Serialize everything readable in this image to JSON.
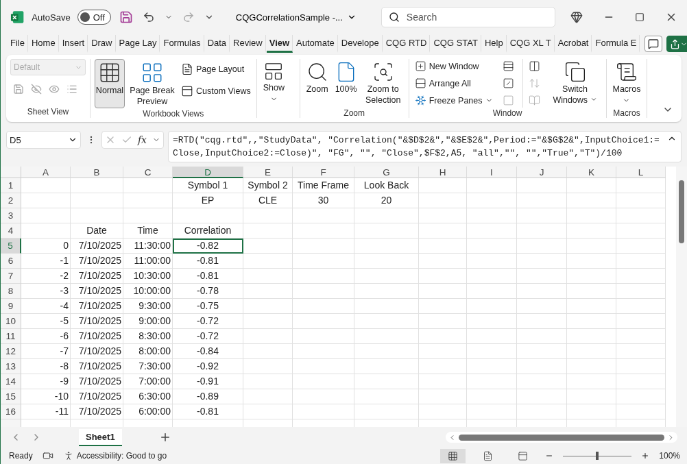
{
  "title_bar": {
    "autosave_label": "AutoSave",
    "autosave": {
      "on": false,
      "label": "Off"
    },
    "title": "CQGCorrelationSample  -...",
    "search": {
      "placeholder": "Search"
    }
  },
  "ribbon_tabs": [
    {
      "label": "File",
      "selected": false
    },
    {
      "label": "Home",
      "selected": false
    },
    {
      "label": "Insert",
      "selected": false
    },
    {
      "label": "Draw",
      "selected": false
    },
    {
      "label": "Page Lay",
      "selected": false
    },
    {
      "label": "Formulas",
      "selected": false
    },
    {
      "label": "Data",
      "selected": false
    },
    {
      "label": "Review",
      "selected": false
    },
    {
      "label": "View",
      "selected": true
    },
    {
      "label": "Automate",
      "selected": false
    },
    {
      "label": "Develope",
      "selected": false
    },
    {
      "label": "CQG RTD",
      "selected": false
    },
    {
      "label": "CQG STAT",
      "selected": false
    },
    {
      "label": "Help",
      "selected": false
    },
    {
      "label": "CQG XL T",
      "selected": false
    },
    {
      "label": "Acrobat",
      "selected": false
    },
    {
      "label": "Formula E",
      "selected": false
    }
  ],
  "ribbon": {
    "sheet_view": {
      "label": "Sheet View",
      "dropdown": {
        "value": "Default",
        "disabled": true
      }
    },
    "workbook_views": {
      "label": "Workbook Views",
      "items": [
        {
          "label": "Normal",
          "selected": true
        },
        {
          "label": "Page Break Preview",
          "selected": false
        },
        {
          "label": "Page Layout",
          "selected": false
        },
        {
          "label": "Custom Views",
          "selected": false
        }
      ]
    },
    "show": {
      "label": "Show"
    },
    "zoom": {
      "label": "Zoom",
      "items": [
        "Zoom",
        "100%",
        "Zoom to Selection"
      ]
    },
    "window": {
      "label": "Window",
      "items": [
        "New Window",
        "Arrange All",
        "Freeze Panes",
        "Switch Windows"
      ]
    },
    "macros": {
      "label": "Macros",
      "button": "Macros"
    }
  },
  "formula_bar": {
    "name_box": "D5",
    "fx": "fx",
    "formula": "=RTD(\"cqg.rtd\",,\"StudyData\", \"Correlation(\"&$D$2&\",\"&$E$2&\",Period:=\"&$G$2&\",InputChoice1:=Close,InputChoice2:=Close)\", \"FG\", \"\", \"Close\",$F$2,A5, \"all\",\"\", \"\",\"True\",\"T\")/100"
  },
  "grid": {
    "columns": [
      {
        "label": "A",
        "selected": false
      },
      {
        "label": "B",
        "selected": false
      },
      {
        "label": "C",
        "selected": false
      },
      {
        "label": "D",
        "selected": true
      },
      {
        "label": "E",
        "selected": false
      },
      {
        "label": "F",
        "selected": false
      },
      {
        "label": "G",
        "selected": false
      },
      {
        "label": "H",
        "selected": false
      },
      {
        "label": "I",
        "selected": false
      },
      {
        "label": "J",
        "selected": false
      },
      {
        "label": "K",
        "selected": false
      },
      {
        "label": "L",
        "selected": false
      }
    ],
    "rows": [
      {
        "label": "1",
        "selected": false,
        "kind": "label",
        "cells": [
          null,
          null,
          null,
          "Symbol 1",
          "Symbol 2",
          "Time Frame",
          "Look Back"
        ]
      },
      {
        "label": "2",
        "selected": false,
        "kind": "label",
        "cells": [
          null,
          null,
          null,
          "EP",
          "CLE",
          "30",
          "20"
        ]
      },
      {
        "label": "3",
        "selected": false,
        "kind": "label"
      },
      {
        "label": "4",
        "selected": false,
        "kind": "label",
        "cells": [
          null,
          "Date",
          "Time",
          "Correlation"
        ]
      },
      {
        "label": "5",
        "selected": true,
        "kind": "data",
        "cells": [
          "0",
          "7/10/2025",
          "11:30:00",
          "-0.82"
        ]
      },
      {
        "label": "6",
        "selected": false,
        "kind": "data",
        "cells": [
          "-1",
          "7/10/2025",
          "11:00:00",
          "-0.81"
        ]
      },
      {
        "label": "7",
        "selected": false,
        "kind": "data",
        "cells": [
          "-2",
          "7/10/2025",
          "10:30:00",
          "-0.81"
        ]
      },
      {
        "label": "8",
        "selected": false,
        "kind": "data",
        "cells": [
          "-3",
          "7/10/2025",
          "10:00:00",
          "-0.78"
        ]
      },
      {
        "label": "9",
        "selected": false,
        "kind": "data",
        "cells": [
          "-4",
          "7/10/2025",
          "9:30:00",
          "-0.75"
        ]
      },
      {
        "label": "10",
        "selected": false,
        "kind": "data",
        "cells": [
          "-5",
          "7/10/2025",
          "9:00:00",
          "-0.72"
        ]
      },
      {
        "label": "11",
        "selected": false,
        "kind": "data",
        "cells": [
          "-6",
          "7/10/2025",
          "8:30:00",
          "-0.72"
        ]
      },
      {
        "label": "12",
        "selected": false,
        "kind": "data",
        "cells": [
          "-7",
          "7/10/2025",
          "8:00:00",
          "-0.84"
        ]
      },
      {
        "label": "13",
        "selected": false,
        "kind": "data",
        "cells": [
          "-8",
          "7/10/2025",
          "7:30:00",
          "-0.92"
        ]
      },
      {
        "label": "14",
        "selected": false,
        "kind": "data",
        "cells": [
          "-9",
          "7/10/2025",
          "7:00:00",
          "-0.91"
        ]
      },
      {
        "label": "15",
        "selected": false,
        "kind": "data",
        "cells": [
          "-10",
          "7/10/2025",
          "6:30:00",
          "-0.89"
        ]
      },
      {
        "label": "16",
        "selected": false,
        "kind": "data",
        "cells": [
          "-11",
          "7/10/2025",
          "6:00:00",
          "-0.81"
        ]
      }
    ]
  },
  "sheet_tabs": [
    {
      "label": "Sheet1",
      "selected": true
    }
  ],
  "status_bar": {
    "status": "Ready",
    "accessibility": "Accessibility: Good to go",
    "views": [
      {
        "selected": true
      },
      {
        "selected": false
      },
      {
        "selected": false
      }
    ],
    "zoom": {
      "level": 0.5,
      "reading": "100%"
    }
  }
}
